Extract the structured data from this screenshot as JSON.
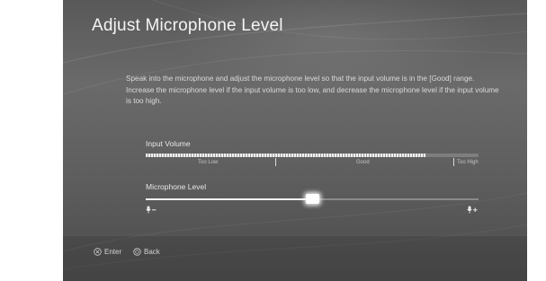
{
  "title": "Adjust Microphone Level",
  "description": {
    "line1": "Speak into the microphone and adjust the microphone level so that the input volume is in the [Good] range.",
    "line2": "Increase the microphone level if the input volume is too low, and decrease the microphone level if the input volume is too high."
  },
  "input_volume": {
    "label": "Input Volume",
    "level": 0.84,
    "ranges": [
      "Too Low",
      "Good",
      "Too High"
    ]
  },
  "microphone_level": {
    "label": "Microphone Level",
    "value": 0.5,
    "decrease_icon": "microphone-minus-icon",
    "increase_icon": "microphone-plus-icon"
  },
  "footer": {
    "enter_label": "Enter",
    "enter_icon": "cross-button-icon",
    "back_label": "Back",
    "back_icon": "circle-button-icon"
  },
  "colors": {
    "accent": "#ffffff",
    "background": "#5e5e5e",
    "text": "#e6e6e6"
  }
}
